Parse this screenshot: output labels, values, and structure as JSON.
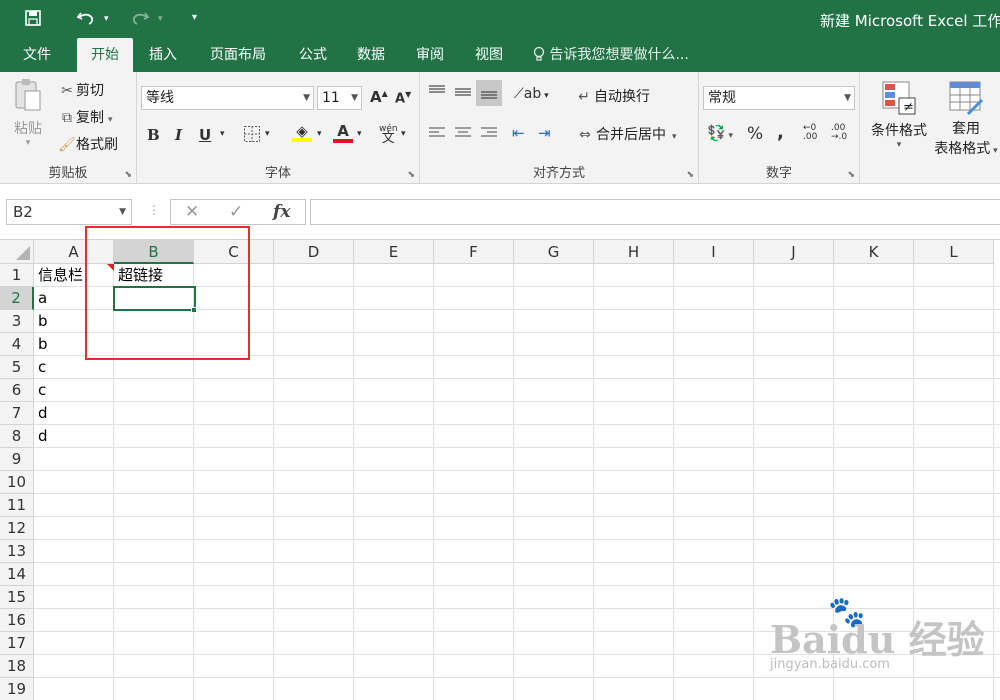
{
  "titlebar": {
    "title": "新建 Microsoft Excel 工作",
    "save_icon": "save-icon",
    "undo_icon": "undo-icon",
    "redo_icon": "redo-icon",
    "customize_icon": "customize-qat-icon"
  },
  "tabs": [
    {
      "label": "文件"
    },
    {
      "label": "开始"
    },
    {
      "label": "插入"
    },
    {
      "label": "页面布局"
    },
    {
      "label": "公式"
    },
    {
      "label": "数据"
    },
    {
      "label": "审阅"
    },
    {
      "label": "视图"
    }
  ],
  "tell_me": "告诉我您想要做什么...",
  "ribbon": {
    "clipboard": {
      "label": "剪贴板",
      "paste": "粘贴",
      "cut": "剪切",
      "copy": "复制",
      "format_painter": "格式刷"
    },
    "font": {
      "label": "字体",
      "font_name": "等线",
      "font_size": "11",
      "bold": "B",
      "italic": "I",
      "underline": "U",
      "font_color_letter": "A",
      "phonetic": "wén"
    },
    "alignment": {
      "label": "对齐方式",
      "wrap_text": "自动换行",
      "merge_center": "合并后居中"
    },
    "number": {
      "label": "数字",
      "format": "常规",
      "percent": "%",
      "comma": ","
    },
    "styles": {
      "conditional": "条件格式",
      "table_line1": "套用",
      "table_line2": "表格格式"
    }
  },
  "formula_bar": {
    "name_box": "B2",
    "fx": "fx",
    "cancel": "✕",
    "enter": "✓",
    "value": ""
  },
  "sheet": {
    "columns": [
      "A",
      "B",
      "C",
      "D",
      "E",
      "F",
      "G",
      "H",
      "I",
      "J",
      "K",
      "L"
    ],
    "rows": [
      "1",
      "2",
      "3",
      "4",
      "5",
      "6",
      "7",
      "8",
      "9",
      "10",
      "11",
      "12",
      "13",
      "14",
      "15",
      "16",
      "17",
      "18",
      "19"
    ],
    "selected_col": "B",
    "selected_row": "2",
    "cells": {
      "A1": "信息栏",
      "B1": "超链接",
      "A2": "a",
      "A3": "b",
      "A4": "b",
      "A5": "c",
      "A6": "c",
      "A7": "d",
      "A8": "d"
    }
  },
  "watermark": {
    "logo": "Baidu 经验",
    "url": "jingyan.baidu.com"
  },
  "colors": {
    "excel_green": "#217346",
    "highlight_red": "#e03030"
  }
}
